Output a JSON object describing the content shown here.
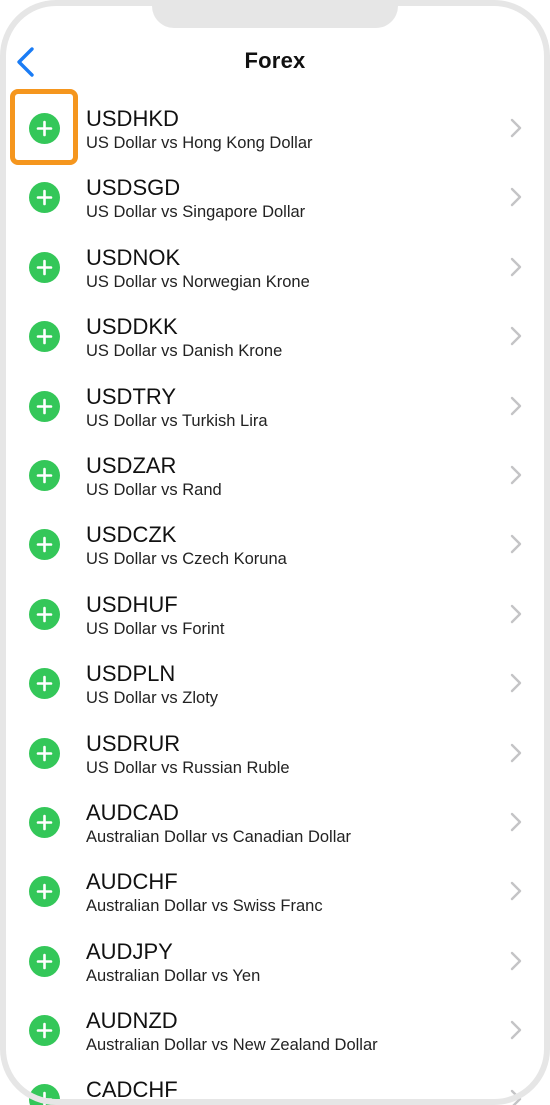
{
  "header": {
    "title": "Forex",
    "back_icon": "chevron-left-icon"
  },
  "colors": {
    "accent": "#1a7cf5",
    "add": "#34c759",
    "highlight": "#f5961e",
    "chevron": "#c4c4c6"
  },
  "icons": {
    "add": "plus-circle-icon",
    "disclosure": "chevron-right-icon"
  },
  "symbols": [
    {
      "symbol": "USDHKD",
      "description": "US Dollar vs Hong Kong Dollar"
    },
    {
      "symbol": "USDSGD",
      "description": "US Dollar vs Singapore Dollar"
    },
    {
      "symbol": "USDNOK",
      "description": "US Dollar vs Norwegian Krone"
    },
    {
      "symbol": "USDDKK",
      "description": "US Dollar vs Danish Krone"
    },
    {
      "symbol": "USDTRY",
      "description": "US Dollar vs Turkish Lira"
    },
    {
      "symbol": "USDZAR",
      "description": "US Dollar vs Rand"
    },
    {
      "symbol": "USDCZK",
      "description": "US Dollar vs Czech Koruna"
    },
    {
      "symbol": "USDHUF",
      "description": "US Dollar vs Forint"
    },
    {
      "symbol": "USDPLN",
      "description": "US Dollar vs Zloty"
    },
    {
      "symbol": "USDRUR",
      "description": "US Dollar vs Russian Ruble"
    },
    {
      "symbol": "AUDCAD",
      "description": "Australian Dollar vs Canadian Dollar"
    },
    {
      "symbol": "AUDCHF",
      "description": "Australian Dollar vs Swiss Franc"
    },
    {
      "symbol": "AUDJPY",
      "description": "Australian Dollar vs Yen"
    },
    {
      "symbol": "AUDNZD",
      "description": "Australian Dollar vs New Zealand Dollar"
    },
    {
      "symbol": "CADCHF",
      "description": ""
    }
  ]
}
